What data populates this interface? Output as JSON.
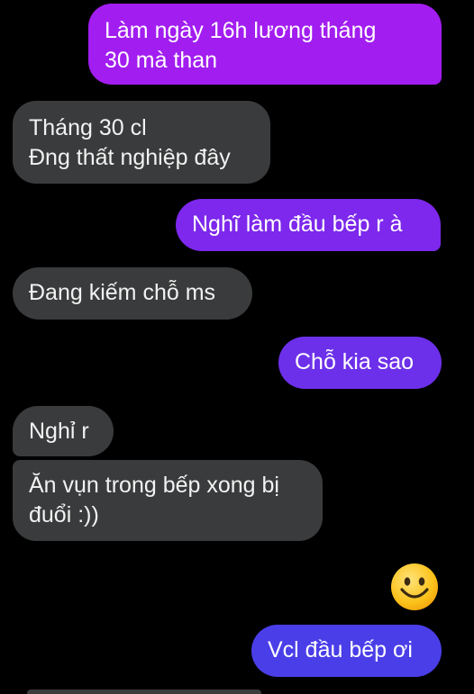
{
  "messages": [
    {
      "id": "msg1",
      "direction": "sent",
      "text": "Làm ngày 16h lương tháng\n30 mà than"
    },
    {
      "id": "msg2",
      "direction": "received",
      "text": "Tháng 30 cl\nĐng thất nghiệp đây"
    },
    {
      "id": "msg3",
      "direction": "sent",
      "text": "Nghĩ làm đầu bếp r à"
    },
    {
      "id": "msg4",
      "direction": "received",
      "text": "Đang kiếm chỗ ms"
    },
    {
      "id": "msg5",
      "direction": "sent",
      "text": "Chỗ kia sao"
    },
    {
      "id": "msg6",
      "direction": "received",
      "text": "Nghỉ r"
    },
    {
      "id": "msg7",
      "direction": "received",
      "text": "Ăn vụn trong bếp xong bị\nđuổi :))"
    },
    {
      "id": "msg8",
      "direction": "sent",
      "text": "Vcl đầu bếp ơi"
    }
  ],
  "reaction_emoji": "smiling-face-icon",
  "colors": {
    "background": "#000000",
    "received_bubble": "#3a3b3c",
    "sent_gradient": [
      "#a21df0",
      "#7d28ec",
      "#6d30ea",
      "#4a3ee8"
    ]
  }
}
